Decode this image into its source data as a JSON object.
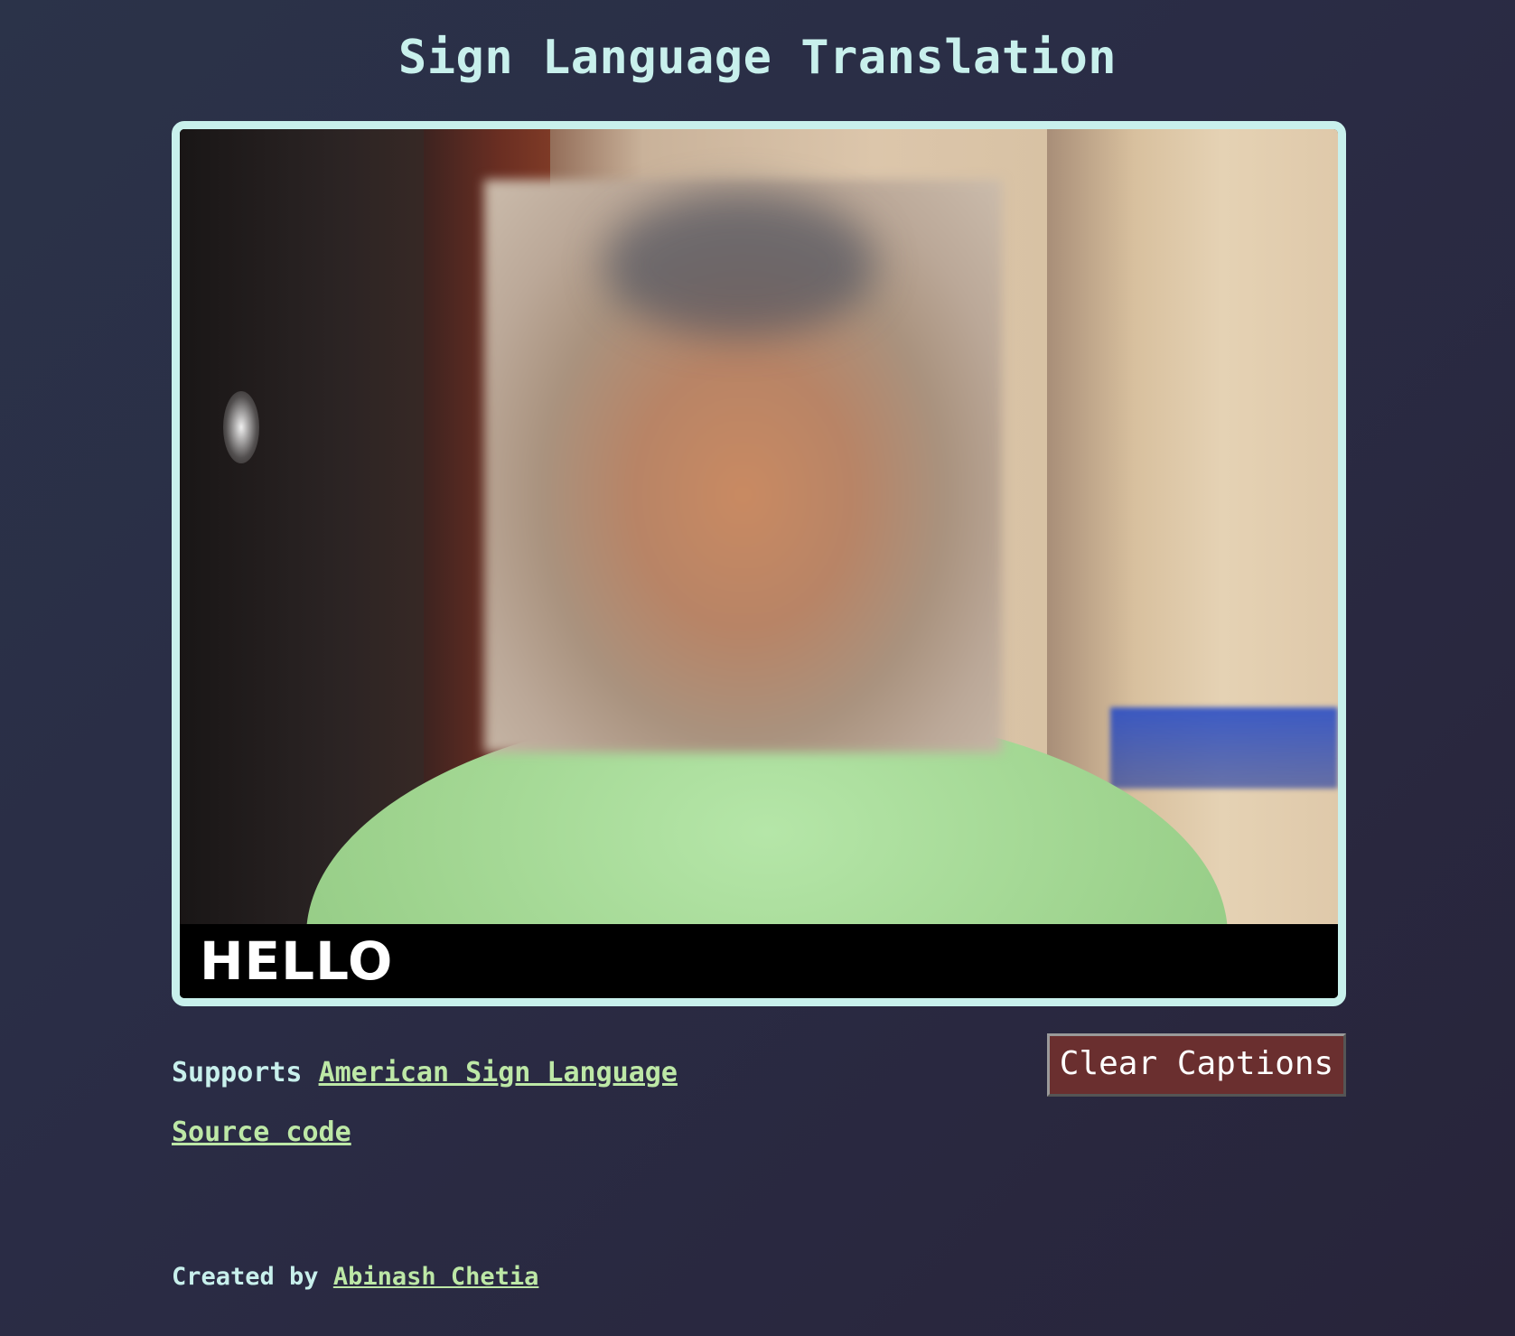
{
  "header": {
    "title": "Sign Language Translation"
  },
  "video": {
    "caption": "HELLO"
  },
  "info": {
    "supports_label": "Supports",
    "language_link": "American Sign Language",
    "source_link": "Source code"
  },
  "controls": {
    "clear_label": "Clear Captions"
  },
  "footer": {
    "created_label": "Created by",
    "author_link": "Abinash Chetia"
  },
  "colors": {
    "accent": "#c8f0ec",
    "link": "#bde8a6",
    "button_bg": "#6a2f2f"
  }
}
